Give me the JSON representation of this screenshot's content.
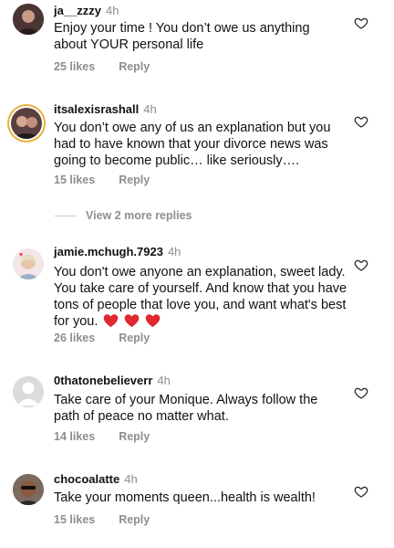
{
  "comments": [
    {
      "username": "ja__zzzy",
      "time": "4h",
      "text": "Enjoy your time ! You don’t owe us anything about YOUR personal life",
      "likes": "25 likes",
      "reply": "Reply"
    },
    {
      "username": "itsalexisrashall",
      "time": "4h",
      "text": "You don’t owe any of us an explanation but you had to have known that your divorce news was going to become public… like seriously….",
      "likes": "15 likes",
      "reply": "Reply"
    },
    {
      "username": "jamie.mchugh.7923",
      "time": "4h",
      "text": "You don't owe anyone an explanation, sweet lady. You take care of yourself. And know that you have tons of people that love you, and want what's best for you.",
      "likes": "26 likes",
      "reply": "Reply"
    },
    {
      "username": "0thatonebelieverr",
      "time": "4h",
      "text": "Take care of your Monique.  Always follow the path of peace no matter what.",
      "likes": "14 likes",
      "reply": "Reply"
    },
    {
      "username": "chocoalatte",
      "time": "4h",
      "text": "Take your moments queen...health is wealth!",
      "likes": "15 likes",
      "reply": "Reply"
    }
  ],
  "view_replies": "View 2 more replies",
  "icons": {
    "like": "heart-outline-icon",
    "emoji": "red-heart-emoji"
  },
  "colors": {
    "emoji_heart": "#e0282e",
    "muted": "#8e8e8e"
  }
}
